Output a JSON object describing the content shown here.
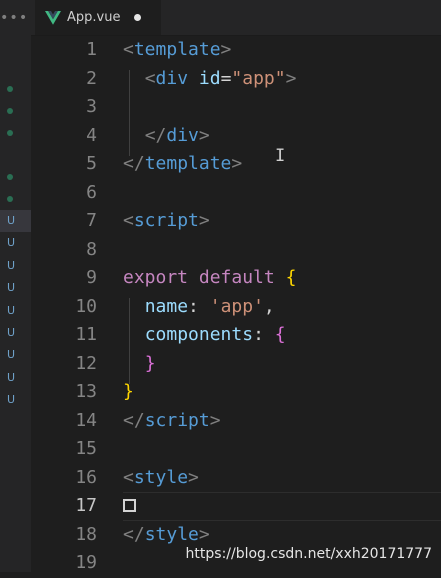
{
  "tab": {
    "filename": "App.vue",
    "icon": "vue-logo-icon",
    "modified_indicator": "unsaved-dot"
  },
  "left_strip": {
    "dots": "•••",
    "git_markers": [
      "U",
      "U",
      "U",
      "U",
      "U",
      "U",
      "U",
      "U",
      "U"
    ]
  },
  "editor": {
    "lines": [
      {
        "n": "1",
        "tokens": [
          [
            "t-bracket",
            "<"
          ],
          [
            "t-tag",
            "template"
          ],
          [
            "t-bracket",
            ">"
          ]
        ]
      },
      {
        "n": "2",
        "tokens": [
          [
            "t-punc",
            "  "
          ],
          [
            "t-bracket",
            "<"
          ],
          [
            "t-tag",
            "div"
          ],
          [
            "t-punc",
            " "
          ],
          [
            "t-attr",
            "id"
          ],
          [
            "t-punc",
            "="
          ],
          [
            "t-str",
            "\"app\""
          ],
          [
            "t-bracket",
            ">"
          ]
        ]
      },
      {
        "n": "3",
        "tokens": []
      },
      {
        "n": "4",
        "tokens": [
          [
            "t-punc",
            "  "
          ],
          [
            "t-bracket",
            "</"
          ],
          [
            "t-tag",
            "div"
          ],
          [
            "t-bracket",
            ">"
          ]
        ]
      },
      {
        "n": "5",
        "tokens": [
          [
            "t-bracket",
            "</"
          ],
          [
            "t-tag",
            "template"
          ],
          [
            "t-bracket",
            ">"
          ]
        ]
      },
      {
        "n": "6",
        "tokens": []
      },
      {
        "n": "7",
        "tokens": [
          [
            "t-bracket",
            "<"
          ],
          [
            "t-tag",
            "script"
          ],
          [
            "t-bracket",
            ">"
          ]
        ]
      },
      {
        "n": "8",
        "tokens": []
      },
      {
        "n": "9",
        "tokens": [
          [
            "t-kw",
            "export"
          ],
          [
            "t-punc",
            " "
          ],
          [
            "t-kw",
            "default"
          ],
          [
            "t-punc",
            " "
          ],
          [
            "t-brace1",
            "{"
          ]
        ]
      },
      {
        "n": "10",
        "tokens": [
          [
            "t-punc",
            "  "
          ],
          [
            "t-prop",
            "name"
          ],
          [
            "t-punc",
            ": "
          ],
          [
            "t-str",
            "'app'"
          ],
          [
            "t-punc",
            ","
          ]
        ]
      },
      {
        "n": "11",
        "tokens": [
          [
            "t-punc",
            "  "
          ],
          [
            "t-prop",
            "components"
          ],
          [
            "t-punc",
            ": "
          ],
          [
            "t-brace2",
            "{"
          ]
        ]
      },
      {
        "n": "12",
        "tokens": [
          [
            "t-punc",
            "  "
          ],
          [
            "t-brace2",
            "}"
          ]
        ]
      },
      {
        "n": "13",
        "tokens": [
          [
            "t-brace1",
            "}"
          ]
        ]
      },
      {
        "n": "14",
        "tokens": [
          [
            "t-bracket",
            "</"
          ],
          [
            "t-tag",
            "script"
          ],
          [
            "t-bracket",
            ">"
          ]
        ]
      },
      {
        "n": "15",
        "tokens": []
      },
      {
        "n": "16",
        "tokens": [
          [
            "t-bracket",
            "<"
          ],
          [
            "t-tag",
            "style"
          ],
          [
            "t-bracket",
            ">"
          ]
        ]
      },
      {
        "n": "17",
        "tokens": [
          [
            "cursor",
            "□"
          ]
        ],
        "active": true
      },
      {
        "n": "18",
        "tokens": [
          [
            "t-bracket",
            "</"
          ],
          [
            "t-tag",
            "style"
          ],
          [
            "t-bracket",
            ">"
          ]
        ]
      },
      {
        "n": "19",
        "tokens": []
      }
    ]
  },
  "watermark": "https://blog.csdn.net/xxh20171777",
  "colors": {
    "background": "#1e1e1e",
    "tag": "#569cd6",
    "string": "#ce9178",
    "keyword": "#c586c0"
  }
}
